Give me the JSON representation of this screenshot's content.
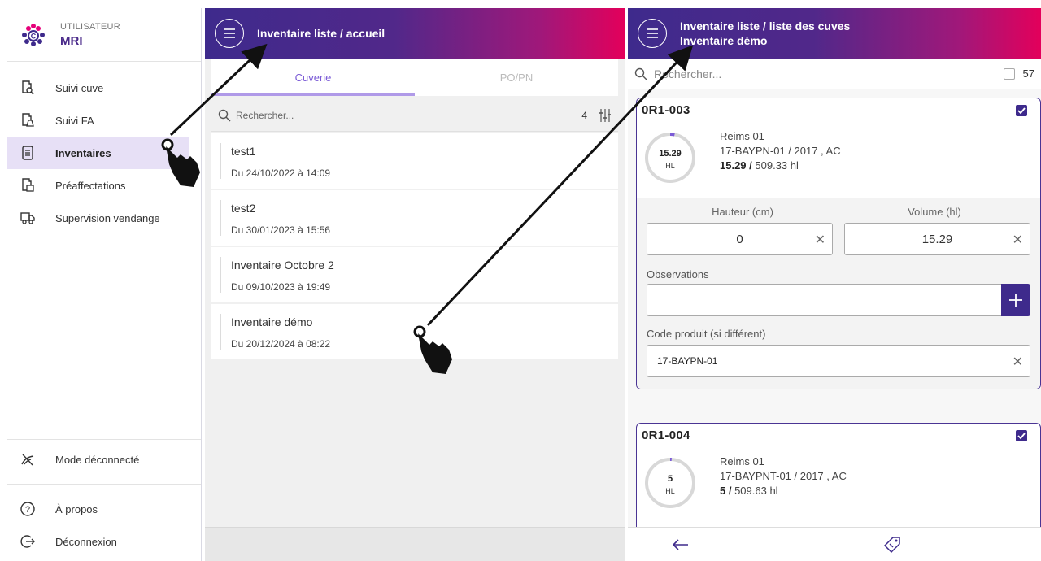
{
  "sidebar": {
    "user_label": "UTILISATEUR",
    "user_name": "MRI",
    "items": [
      {
        "label": "Suivi cuve",
        "icon": "tank-search-icon"
      },
      {
        "label": "Suivi FA",
        "icon": "tank-flask-icon"
      },
      {
        "label": "Inventaires",
        "icon": "inventory-icon",
        "active": true
      },
      {
        "label": "Préaffectations",
        "icon": "tank-assign-icon"
      },
      {
        "label": "Supervision vendange",
        "icon": "truck-icon"
      }
    ],
    "offline_label": "Mode déconnecté",
    "about_label": "À propos",
    "logout_label": "Déconnexion"
  },
  "panel_home": {
    "title": "Inventaire liste / accueil",
    "tabs": [
      "Cuverie",
      "PO/PN"
    ],
    "search_placeholder": "Rechercher...",
    "count": "4",
    "items": [
      {
        "title": "test1",
        "date": "Du 24/10/2022 à 14:09"
      },
      {
        "title": "test2",
        "date": "Du 30/01/2023 à 15:56"
      },
      {
        "title": "Inventaire Octobre 2",
        "date": "Du 09/10/2023 à 19:49"
      },
      {
        "title": "Inventaire démo",
        "date": "Du 20/12/2024 à 08:22"
      }
    ]
  },
  "panel_tanks": {
    "title_line1": "Inventaire liste / liste des cuves",
    "title_line2": "Inventaire démo",
    "search_placeholder": "Rechercher...",
    "count": "57",
    "cards": [
      {
        "code": "0R1-003",
        "gauge_value": "15.29",
        "gauge_unit": "HL",
        "fill_fraction": 0.03,
        "site": "Reims 01",
        "product": "17-BAYPN-01 / 2017 , AC",
        "volume": "15.29",
        "capacity": "509.33 hl",
        "height_label": "Hauteur (cm)",
        "height_value": "0",
        "volume_label": "Volume (hl)",
        "volume_value": "15.29",
        "obs_label": "Observations",
        "code_label": "Code produit (si différent)",
        "code_value": "17-BAYPN-01"
      },
      {
        "code": "0R1-004",
        "gauge_value": "5",
        "gauge_unit": "HL",
        "fill_fraction": 0.01,
        "site": "Reims 01",
        "product": "17-BAYPNT-01 / 2017 , AC",
        "volume": "5",
        "capacity": "509.63 hl"
      }
    ]
  },
  "colors": {
    "accent": "#3e2a8c",
    "active_bg": "#e7e0f6",
    "tab_active": "#7b5bd6"
  }
}
